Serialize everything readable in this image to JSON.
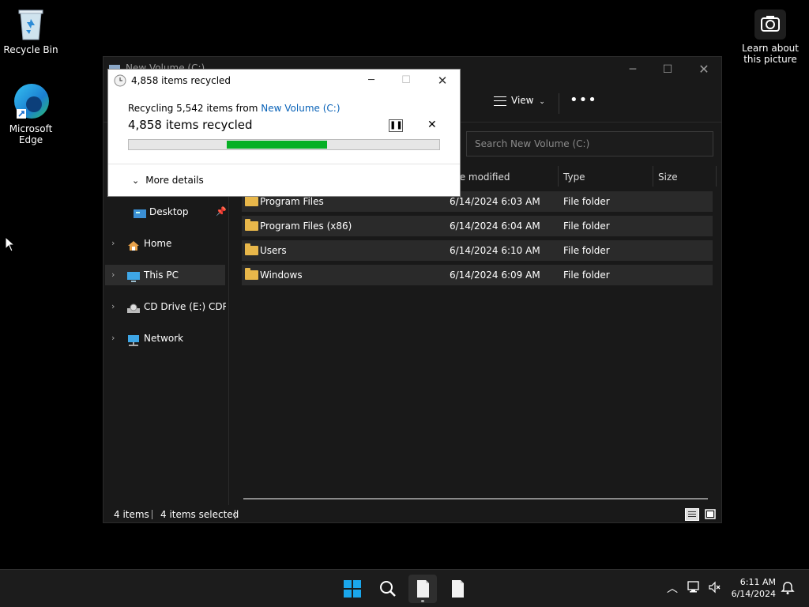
{
  "desktop": {
    "recycle_bin_label": "Recycle Bin",
    "edge_label_1": "Microsoft",
    "edge_label_2": "Edge",
    "spotlight_label_1": "Learn about",
    "spotlight_label_2": "this picture"
  },
  "explorer": {
    "title": "New Volume (C:)",
    "toolbar": {
      "view_label": "View",
      "more_label": "•••"
    },
    "search_placeholder": "Search New Volume (C:)",
    "columns": {
      "date": "te modified",
      "type": "Type",
      "size": "Size"
    },
    "sidebar": [
      {
        "label": "Desktop",
        "pinned": true
      },
      {
        "label": "Home"
      },
      {
        "label": "This PC",
        "selected": true
      },
      {
        "label": "CD Drive (E:) CDROM"
      },
      {
        "label": "Network"
      }
    ],
    "rows": [
      {
        "name": "Program Files",
        "date": "6/14/2024 6:03 AM",
        "type": "File folder"
      },
      {
        "name": "Program Files (x86)",
        "date": "6/14/2024 6:04 AM",
        "type": "File folder"
      },
      {
        "name": "Users",
        "date": "6/14/2024 6:10 AM",
        "type": "File folder"
      },
      {
        "name": "Windows",
        "date": "6/14/2024 6:09 AM",
        "type": "File folder"
      }
    ],
    "status": {
      "count": "4 items",
      "selected": "4 items selected"
    }
  },
  "dialog": {
    "title": "4,858 items recycled",
    "line_prefix": "Recycling 5,542 items from ",
    "line_link": "New Volume (C:)",
    "headline": "4,858 items recycled",
    "more_details": "More details",
    "progress_bar_colors": {
      "fill": "#06b025",
      "track": "#e6e6e6"
    }
  },
  "taskbar": {
    "time": "6:11 AM",
    "date": "6/14/2024"
  }
}
